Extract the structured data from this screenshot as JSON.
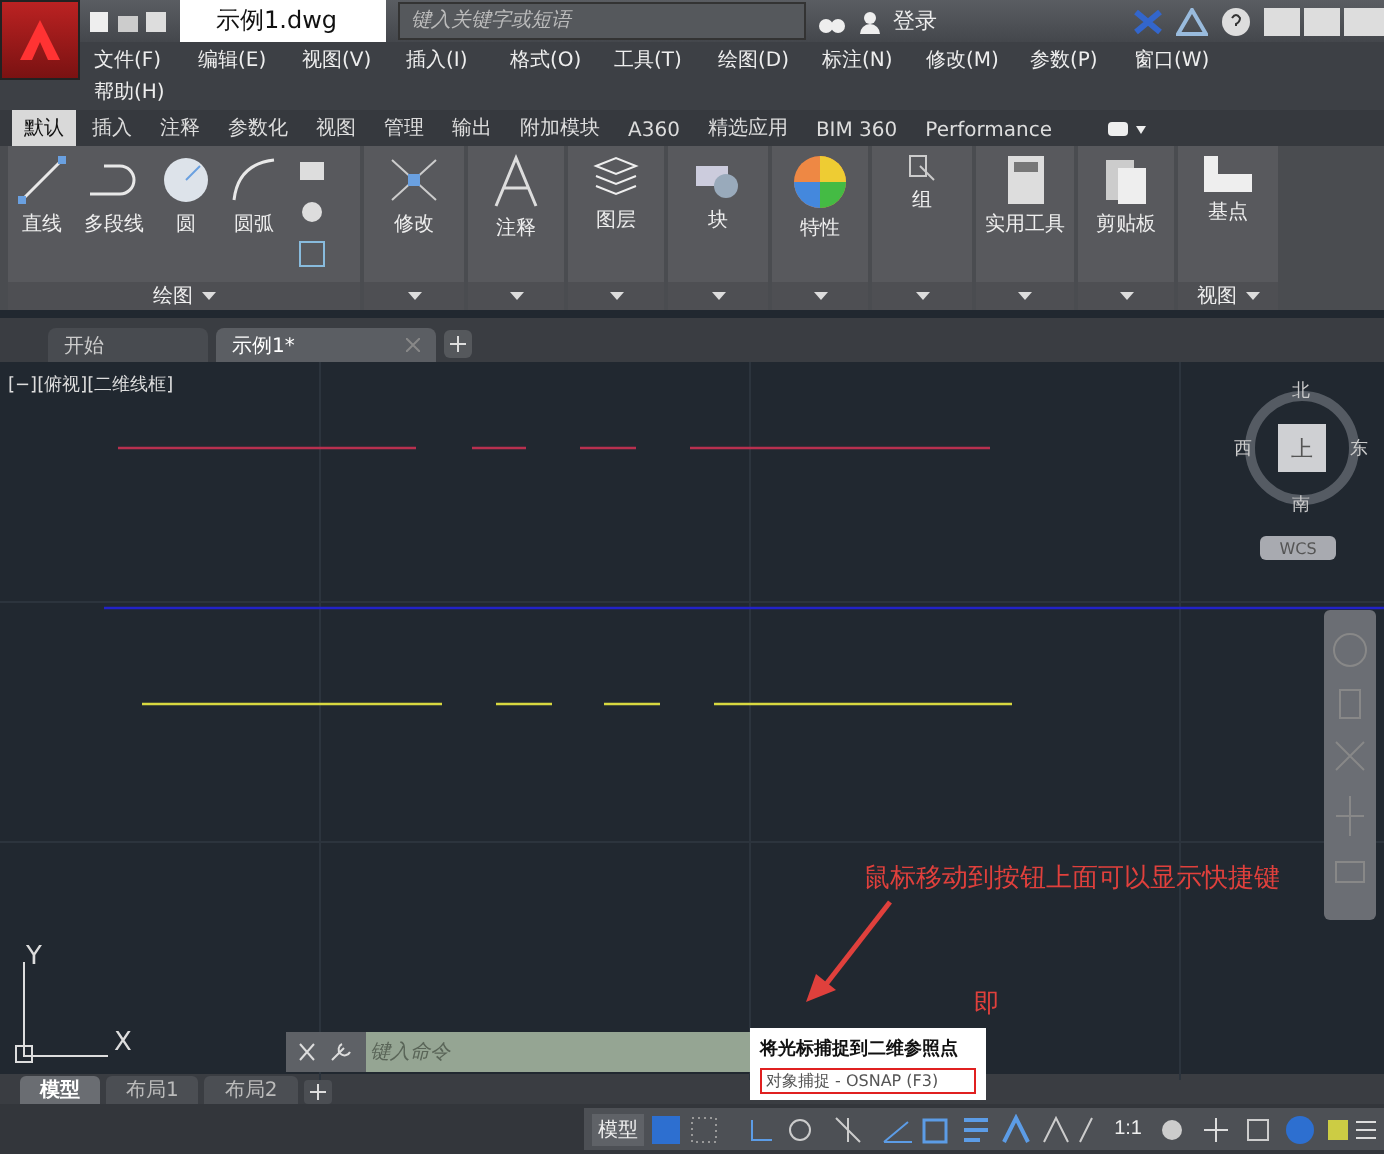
{
  "title_bar": {
    "title": "示例1.dwg",
    "search": {
      "placeholder": "键入关键字或短语"
    },
    "sign_in": "登录"
  },
  "menu": [
    "文件(F)",
    "编辑(E)",
    "视图(V)",
    "插入(I)",
    "格式(O)",
    "工具(T)",
    "绘图(D)",
    "标注(N)",
    "修改(M)",
    "参数(P)",
    "窗口(W)",
    "帮助(H)"
  ],
  "ribbon_tabs": [
    {
      "label": "默认",
      "selected": true
    },
    {
      "label": "插入",
      "selected": false
    },
    {
      "label": "注释",
      "selected": false
    },
    {
      "label": "参数化",
      "selected": false
    },
    {
      "label": "视图",
      "selected": false
    },
    {
      "label": "管理",
      "selected": false
    },
    {
      "label": "输出",
      "selected": false
    },
    {
      "label": "附加模块",
      "selected": false
    },
    {
      "label": "A360",
      "selected": false
    },
    {
      "label": "精选应用",
      "selected": false
    },
    {
      "label": "BIM 360",
      "selected": false
    },
    {
      "label": "Performance",
      "selected": false
    }
  ],
  "ribbon_panels": [
    {
      "title": "绘图",
      "tools": [
        "直线",
        "多段线",
        "圆",
        "圆弧"
      ]
    },
    {
      "tools": [
        "修改"
      ]
    },
    {
      "tools": [
        "注释"
      ]
    },
    {
      "tools": [
        "图层"
      ]
    },
    {
      "tools": [
        "块"
      ]
    },
    {
      "tools": [
        "特性"
      ]
    },
    {
      "tools": [
        "组"
      ]
    },
    {
      "tools": [
        "实用工具"
      ]
    },
    {
      "tools": [
        "剪贴板"
      ]
    },
    {
      "title": "视图",
      "tools": [
        "基点"
      ]
    }
  ],
  "doc_tabs": [
    {
      "label": "开始",
      "selected": false
    },
    {
      "label": "示例1*",
      "selected": true
    }
  ],
  "viewport": {
    "label": "[−][俯视][二维线框]",
    "viewcube": {
      "north": "北",
      "south": "南",
      "east": "东",
      "west": "西",
      "face": "上",
      "ucs": "WCS"
    },
    "ucs_x": "X",
    "ucs_y": "Y"
  },
  "command_line": {
    "placeholder": "键入命令"
  },
  "annotation": {
    "text": "鼠标移动到按钮上面可以显示快捷键",
    "partial": "即"
  },
  "tooltip": {
    "title": "将光标捕捉到二维参照点",
    "shortcut": "对象捕捉 - OSNAP (F3)"
  },
  "layout_tabs": [
    {
      "label": "模型",
      "selected": true
    },
    {
      "label": "布局1",
      "selected": false
    },
    {
      "label": "布局2",
      "selected": false
    }
  ],
  "status_bar": {
    "model": "模型",
    "scale": "1:1"
  }
}
